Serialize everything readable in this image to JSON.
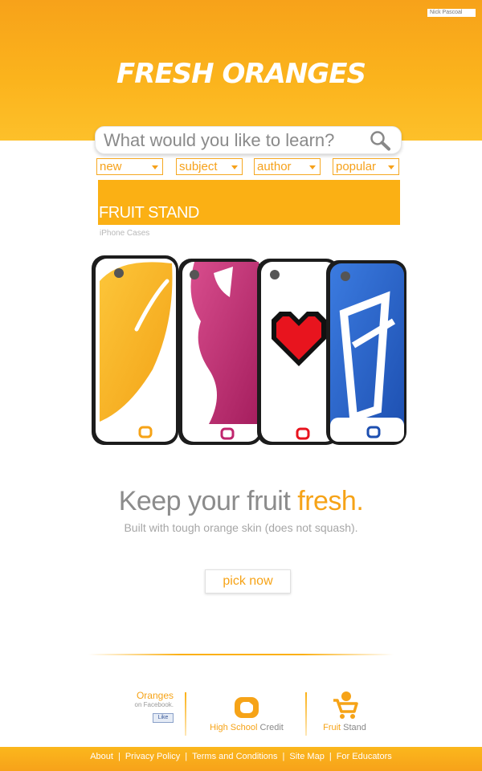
{
  "header": {
    "user_name": "Nick Pascoal",
    "logo_text": "FRESH ORANGES"
  },
  "search": {
    "placeholder": "What would you like to learn?",
    "icon": "search-icon"
  },
  "filters": [
    {
      "label": "new"
    },
    {
      "label": "subject"
    },
    {
      "label": "author"
    },
    {
      "label": "popular"
    }
  ],
  "banner": {
    "title": "FRUIT STAND",
    "subtitle": "iPhone Cases"
  },
  "promo": {
    "headline_plain": "Keep your fruit ",
    "headline_accent": "fresh.",
    "subline": "Built with tough orange skin (does not squash).",
    "cta_label": "pick now"
  },
  "footer": {
    "facebook": {
      "title": "Oranges",
      "subtitle": "on Facebook.",
      "like_label": "Like"
    },
    "high_school": {
      "accent": "High School",
      "rest": " Credit"
    },
    "fruit_stand": {
      "accent": "Fruit",
      "rest": " Stand"
    },
    "links": [
      "About",
      "Privacy Policy",
      "Terms and Conditions",
      "Site Map",
      "For Educators"
    ]
  },
  "colors": {
    "brand_orange": "#fbb014",
    "accent_text": "#f6a317",
    "gray_text": "#8c8c8c"
  }
}
